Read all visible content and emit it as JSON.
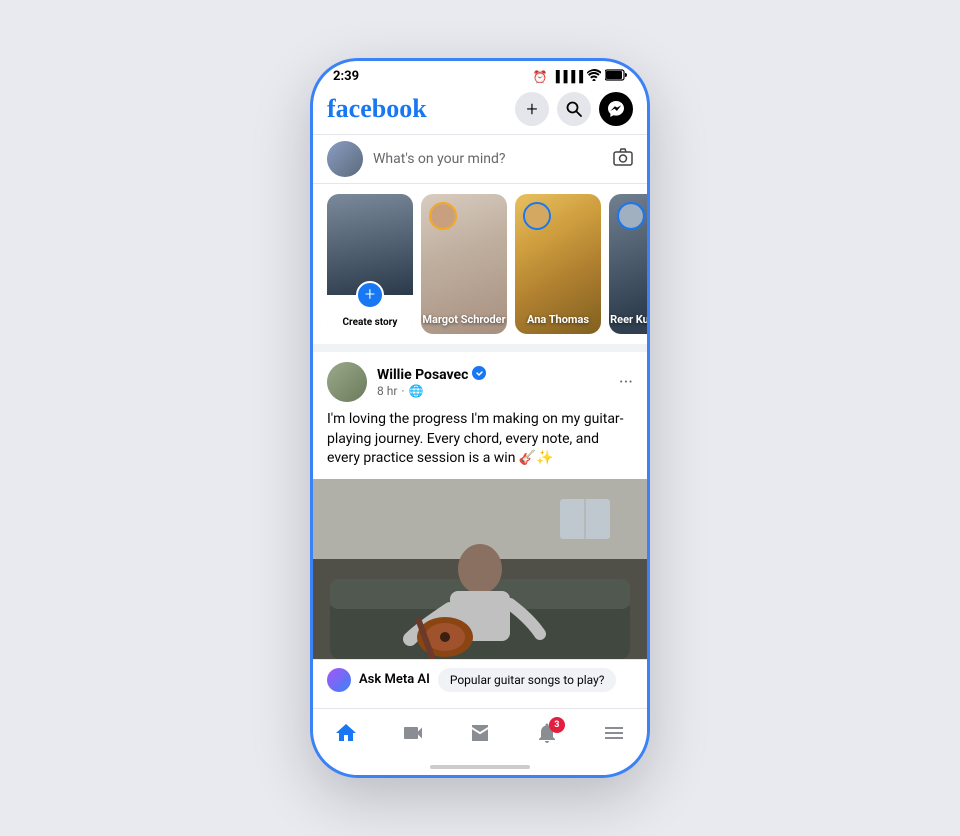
{
  "status_bar": {
    "time": "2:39",
    "signal_icon": "▐▐▐▐",
    "wifi_icon": "wifi",
    "battery_icon": "battery"
  },
  "header": {
    "logo": "facebook",
    "icons": {
      "add": "+",
      "search": "🔍",
      "messenger": "💬"
    }
  },
  "post_box": {
    "placeholder": "What's on your mind?"
  },
  "stories": [
    {
      "id": "create",
      "label": "Create story",
      "type": "create"
    },
    {
      "id": "margot",
      "label": "Margot Schroder",
      "type": "user",
      "ring_color": "orange"
    },
    {
      "id": "ana",
      "label": "Ana Thomas",
      "type": "user",
      "ring_color": "blue"
    },
    {
      "id": "reer",
      "label": "Reer Kum...",
      "type": "user",
      "ring_color": "blue"
    }
  ],
  "feed": {
    "post": {
      "author": "Willie Posavec",
      "verified": true,
      "time": "8 hr",
      "globe": "🌐",
      "text": "I'm loving the progress I'm making on my guitar-playing journey. Every chord, every note, and every practice session is a win 🎸✨"
    }
  },
  "meta_ai": {
    "label": "Ask Meta AI",
    "suggestion": "Popular guitar songs to play?"
  },
  "bottom_nav": {
    "items": [
      {
        "id": "home",
        "icon": "home",
        "active": true
      },
      {
        "id": "video",
        "icon": "video",
        "active": false
      },
      {
        "id": "marketplace",
        "icon": "shop",
        "active": false
      },
      {
        "id": "notifications",
        "icon": "bell",
        "active": false,
        "badge": "3"
      },
      {
        "id": "menu",
        "icon": "menu",
        "active": false
      }
    ]
  }
}
